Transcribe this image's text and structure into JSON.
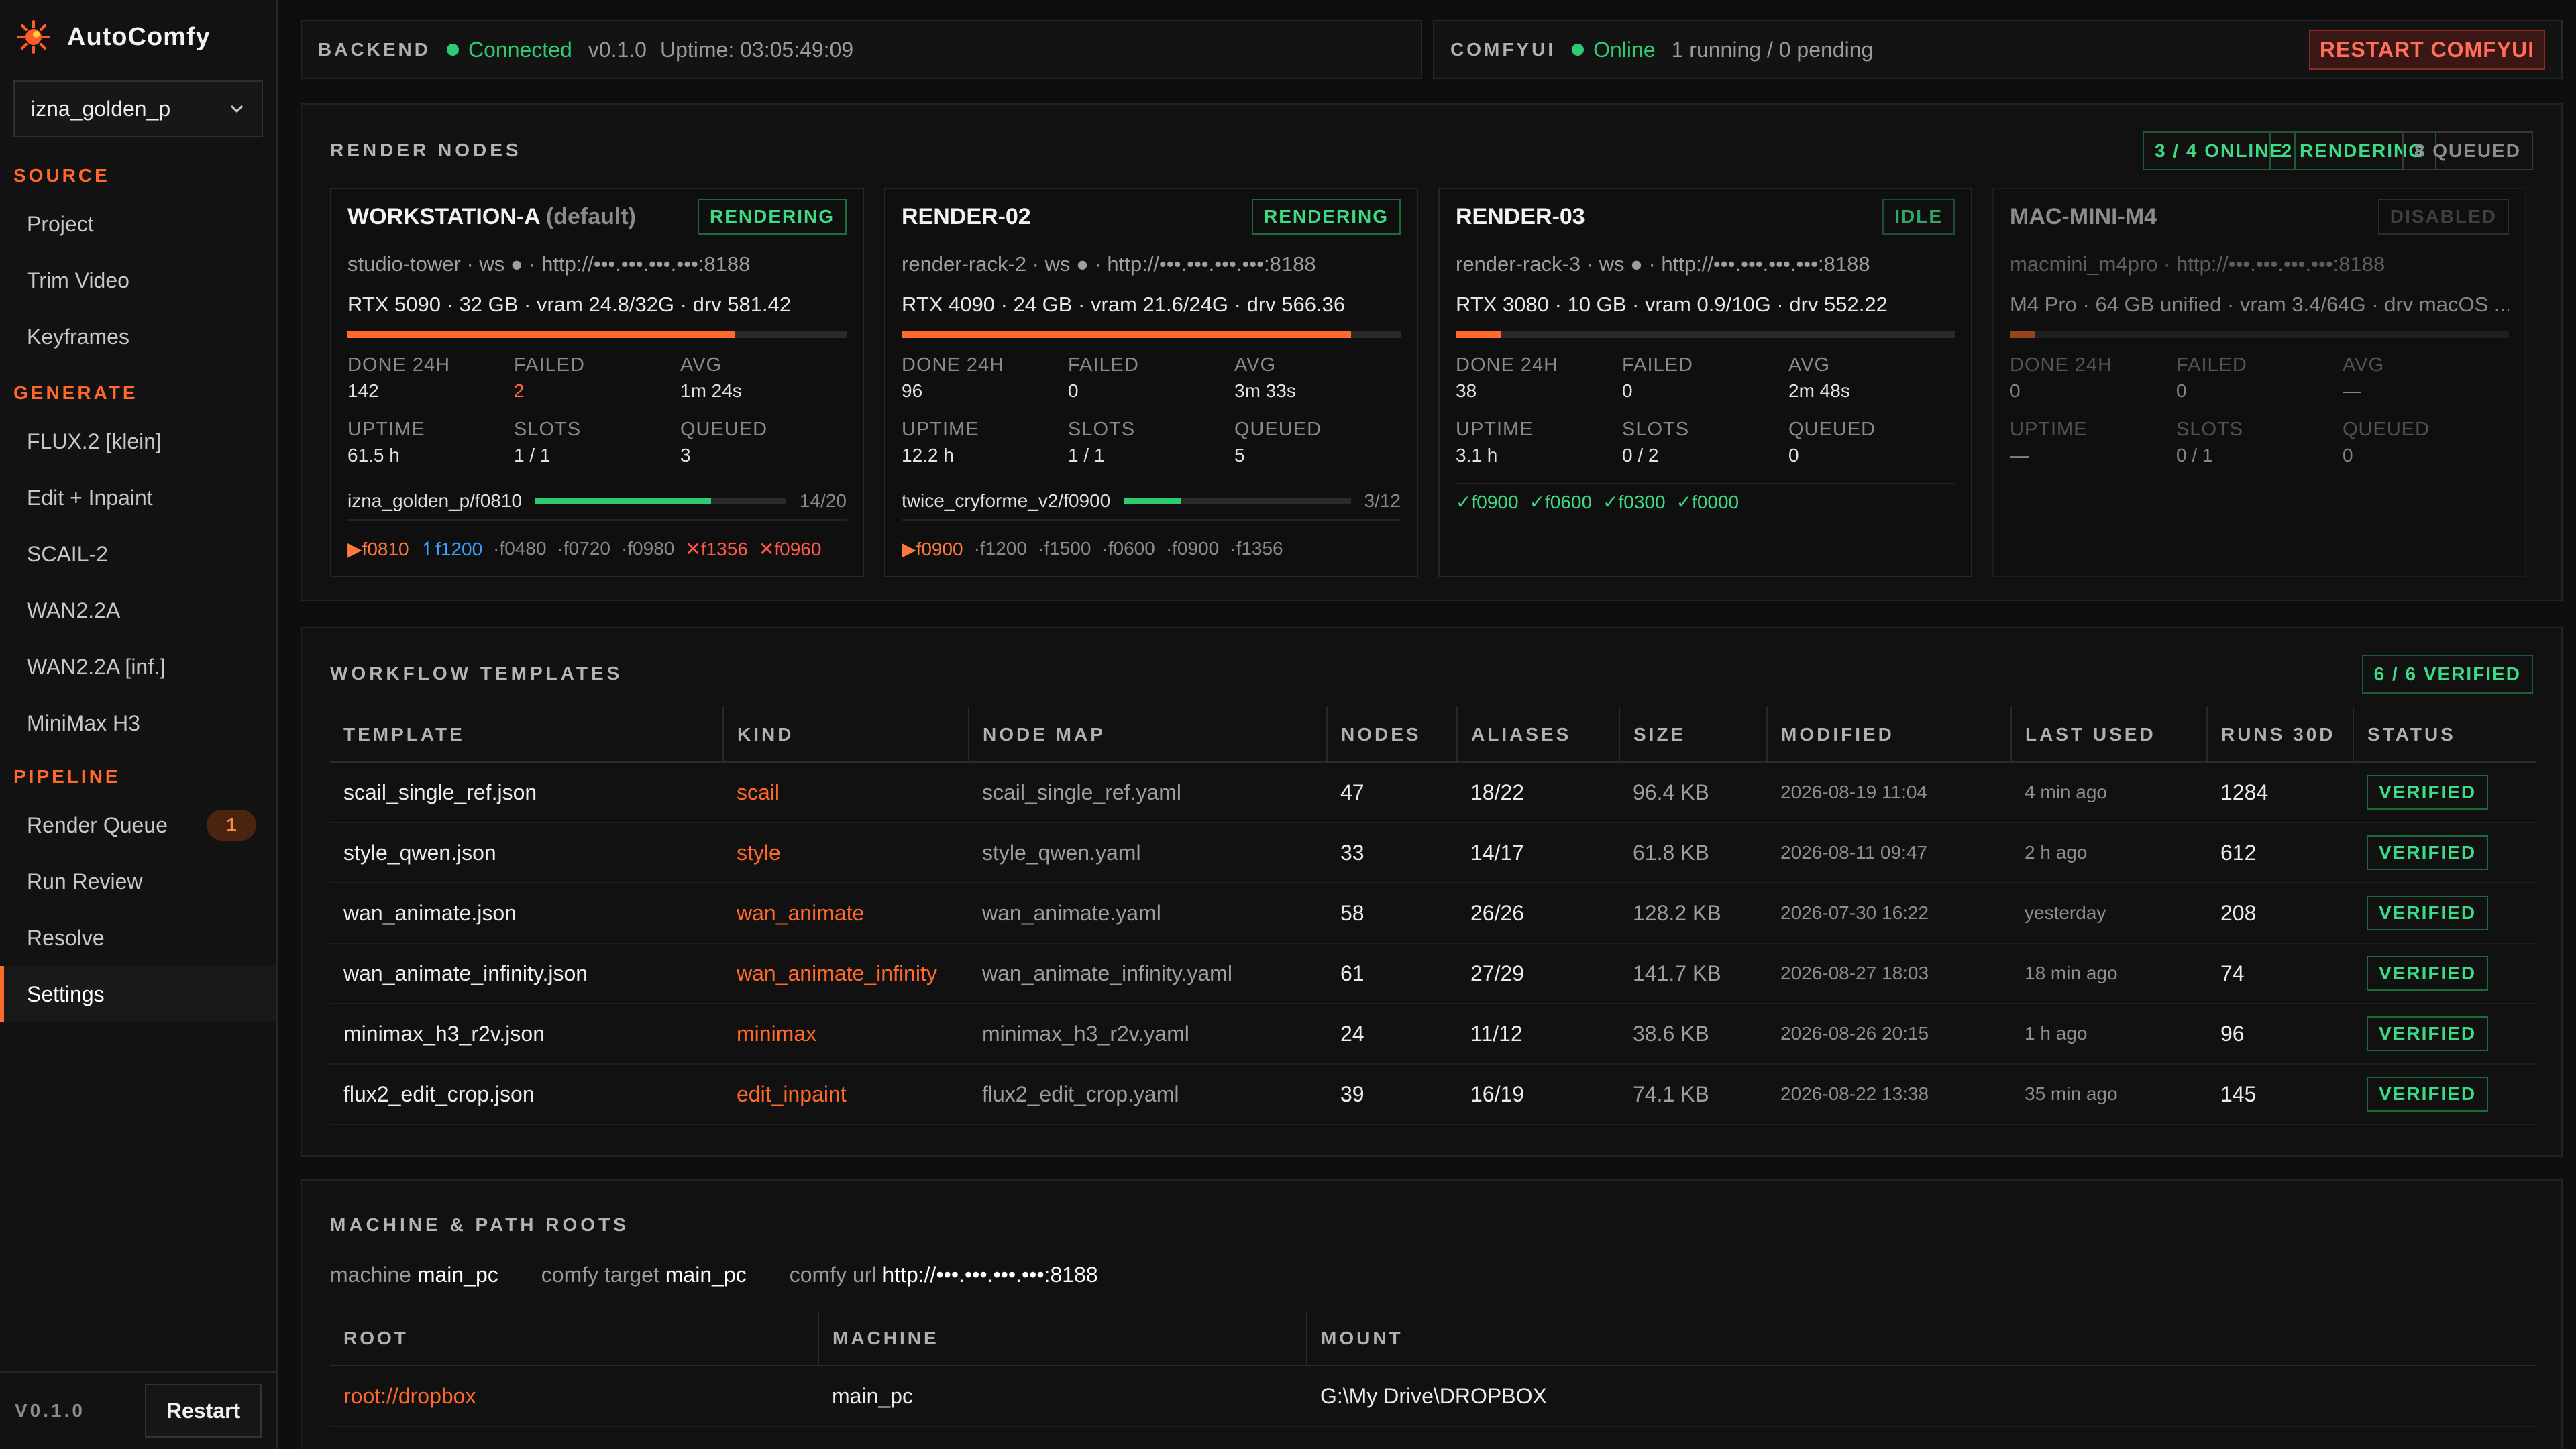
{
  "sidebar": {
    "brand": "AutoComfy",
    "project": "izna_golden_p",
    "sections": {
      "source": "SOURCE",
      "generate": "GENERATE",
      "pipeline": "PIPELINE"
    },
    "source_items": [
      "Project",
      "Trim Video",
      "Keyframes"
    ],
    "generate_items": [
      "FLUX.2 [klein]",
      "Edit + Inpaint",
      "SCAIL-2",
      "WAN2.2A",
      "WAN2.2A [inf.]",
      "MiniMax H3"
    ],
    "pipeline_items": [
      "Render Queue",
      "Run Review",
      "Resolve",
      "Settings"
    ],
    "render_queue_badge": "1",
    "active_item": "Settings",
    "version": "V0.1.0",
    "restart_label": "Restart"
  },
  "backend": {
    "label": "BACKEND",
    "status": "Connected",
    "version": "v0.1.0",
    "uptime": "Uptime: 03:05:49:09"
  },
  "comfyui": {
    "label": "COMFYUI",
    "status": "Online",
    "jobs": "1 running / 0 pending",
    "restart_label": "RESTART COMFYUI"
  },
  "render_nodes": {
    "title": "RENDER NODES",
    "pills": [
      "3 / 4 ONLINE",
      "2 RENDERING",
      "8 QUEUED"
    ],
    "stat_labels": {
      "done": "DONE 24H",
      "failed": "FAILED",
      "avg": "AVG",
      "uptime": "UPTIME",
      "slots": "SLOTS",
      "queued": "QUEUED"
    },
    "nodes": [
      {
        "name": "WORKSTATION-A",
        "default_tag": "(default)",
        "state": "RENDERING",
        "host": "studio-tower · ws ● · http://•••.•••.•••.•••:8188",
        "spec": "RTX 5090 · 32 GB · vram 24.8/32G · drv 581.42",
        "vram_fraction": 0.775,
        "done": "142",
        "failed": "2",
        "avg": "1m 24s",
        "uptime": "61.5 h",
        "slots": "1 / 1",
        "queued": "3",
        "job": "izna_golden_p/f0810",
        "job_progress": 0.7,
        "job_count": "14/20",
        "frames": [
          {
            "t": "▶f0810",
            "s": "active"
          },
          {
            "t": "↿f1200",
            "s": "blue"
          },
          {
            "t": "·f0480",
            "s": "queued"
          },
          {
            "t": "·f0720",
            "s": "queued"
          },
          {
            "t": "·f0980",
            "s": "queued"
          },
          {
            "t": "✕f1356",
            "s": "fail"
          },
          {
            "t": "✕f0960",
            "s": "fail"
          }
        ]
      },
      {
        "name": "RENDER-02",
        "default_tag": "",
        "state": "RENDERING",
        "host": "render-rack-2 · ws ● · http://•••.•••.•••.•••:8188",
        "spec": "RTX 4090 · 24 GB · vram 21.6/24G · drv 566.36",
        "vram_fraction": 0.9,
        "done": "96",
        "failed": "0",
        "avg": "3m 33s",
        "uptime": "12.2 h",
        "slots": "1 / 1",
        "queued": "5",
        "job": "twice_cryforme_v2/f0900",
        "job_progress": 0.25,
        "job_count": "3/12",
        "frames": [
          {
            "t": "▶f0900",
            "s": "active"
          },
          {
            "t": "·f1200",
            "s": "queued"
          },
          {
            "t": "·f1500",
            "s": "queued"
          },
          {
            "t": "·f0600",
            "s": "queued"
          },
          {
            "t": "·f0900",
            "s": "queued"
          },
          {
            "t": "·f1356",
            "s": "queued"
          }
        ]
      },
      {
        "name": "RENDER-03",
        "default_tag": "",
        "state": "IDLE",
        "host": "render-rack-3 · ws ● · http://•••.•••.•••.•••:8188",
        "spec": "RTX 3080 · 10 GB · vram 0.9/10G · drv 552.22",
        "vram_fraction": 0.09,
        "done": "38",
        "failed": "0",
        "avg": "2m 48s",
        "uptime": "3.1 h",
        "slots": "0 / 2",
        "queued": "0",
        "frames": [
          {
            "t": "✓f0900",
            "s": "ok"
          },
          {
            "t": "✓f0600",
            "s": "ok"
          },
          {
            "t": "✓f0300",
            "s": "ok"
          },
          {
            "t": "✓f0000",
            "s": "ok"
          }
        ]
      },
      {
        "name": "MAC-MINI-M4",
        "default_tag": "",
        "state": "DISABLED",
        "host": "macmini_m4pro · http://•••.•••.•••.•••:8188",
        "spec": "M4 Pro · 64 GB unified · vram 3.4/64G · drv macOS ...",
        "vram_fraction": 0.05,
        "done": "0",
        "failed": "0",
        "avg": "—",
        "uptime": "—",
        "slots": "0 / 1",
        "queued": "0"
      }
    ]
  },
  "workflow_templates": {
    "title": "WORKFLOW TEMPLATES",
    "pill": "6 / 6 VERIFIED",
    "columns": [
      "TEMPLATE",
      "KIND",
      "NODE MAP",
      "NODES",
      "ALIASES",
      "SIZE",
      "MODIFIED",
      "LAST USED",
      "RUNS 30D",
      "STATUS"
    ],
    "rows": [
      [
        "scail_single_ref.json",
        "scail",
        "scail_single_ref.yaml",
        "47",
        "18/22",
        "96.4 KB",
        "2026-08-19 11:04",
        "4 min ago",
        "1284",
        "VERIFIED"
      ],
      [
        "style_qwen.json",
        "style",
        "style_qwen.yaml",
        "33",
        "14/17",
        "61.8 KB",
        "2026-08-11 09:47",
        "2 h ago",
        "612",
        "VERIFIED"
      ],
      [
        "wan_animate.json",
        "wan_animate",
        "wan_animate.yaml",
        "58",
        "26/26",
        "128.2 KB",
        "2026-07-30 16:22",
        "yesterday",
        "208",
        "VERIFIED"
      ],
      [
        "wan_animate_infinity.json",
        "wan_animate_infinity",
        "wan_animate_infinity.yaml",
        "61",
        "27/29",
        "141.7 KB",
        "2026-08-27 18:03",
        "18 min ago",
        "74",
        "VERIFIED"
      ],
      [
        "minimax_h3_r2v.json",
        "minimax",
        "minimax_h3_r2v.yaml",
        "24",
        "11/12",
        "38.6 KB",
        "2026-08-26 20:15",
        "1 h ago",
        "96",
        "VERIFIED"
      ],
      [
        "flux2_edit_crop.json",
        "edit_inpaint",
        "flux2_edit_crop.yaml",
        "39",
        "16/19",
        "74.1 KB",
        "2026-08-22 13:38",
        "35 min ago",
        "145",
        "VERIFIED"
      ]
    ]
  },
  "machine": {
    "title": "MACHINE & PATH ROOTS",
    "machine_label": "machine",
    "machine_value": "main_pc",
    "target_label": "comfy target",
    "target_value": "main_pc",
    "url_label": "comfy url",
    "url_value": "http://•••.•••.•••.•••:8188",
    "columns": [
      "ROOT",
      "MACHINE",
      "MOUNT"
    ],
    "rows": [
      [
        "root://dropbox",
        "main_pc",
        "G:\\My Drive\\DROPBOX"
      ]
    ]
  },
  "colors": {
    "accent": "#ff6a2a",
    "ok": "#3ddc84",
    "danger": "#ff5a4a",
    "info": "#3aa0ff",
    "bg": "#0e0e0f"
  }
}
